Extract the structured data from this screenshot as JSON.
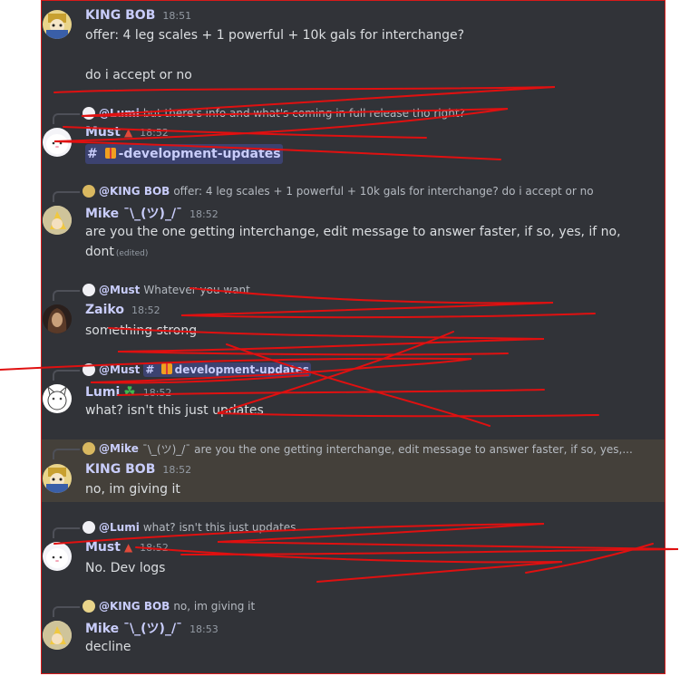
{
  "messages": [
    {
      "author": "KING BOB",
      "time": "18:51",
      "lines": [
        "offer: 4 leg scales + 1 powerful + 10k gals for interchange?",
        "do i accept or no"
      ]
    },
    {
      "reply": {
        "name": "@Lumi",
        "text": "but there's info and what's coming in full release tho right?"
      },
      "author": "Must",
      "role_icon": "▲",
      "time": "18:52",
      "channel": {
        "hash": "#",
        "name": "-development-updates"
      }
    },
    {
      "reply": {
        "name": "@KING BOB",
        "text": "offer: 4 leg scales + 1 powerful + 10k gals for interchange?  do i accept or no"
      },
      "author": "Mike ¯\\_(ツ)_/¯",
      "time": "18:52",
      "lines": [
        "are you the one getting interchange, edit message to answer faster, if so, yes, if no,",
        "dont"
      ],
      "edited": "(edited)"
    },
    {
      "reply": {
        "name": "@Must",
        "text": "Whatever you want"
      },
      "author": "Zaiko",
      "time": "18:52",
      "lines": [
        "something strong"
      ]
    },
    {
      "reply": {
        "name": "@Must",
        "hash": "#",
        "channel": "development-updates"
      },
      "author": "Lumi",
      "role_icon": "☘",
      "time": "18:52",
      "lines": [
        "what? isn't this just updates"
      ]
    },
    {
      "reply": {
        "name": "@Mike",
        "text": "¯\\_(ツ)_/¯  are you the one getting interchange, edit message to answer faster, if so, yes,..."
      },
      "author": "KING BOB",
      "time": "18:52",
      "lines": [
        "no, im giving it"
      ]
    },
    {
      "reply": {
        "name": "@Lumi",
        "text": "what? isn't this just updates"
      },
      "author": "Must",
      "role_icon": "▲",
      "time": "18:52",
      "lines": [
        "No. Dev logs"
      ]
    },
    {
      "reply": {
        "name": "@KING BOB",
        "text": "no, im giving it"
      },
      "author": "Mike ¯\\_(ツ)_/¯",
      "time": "18:53",
      "lines": [
        "decline"
      ]
    }
  ],
  "colors": {
    "background": "#313338",
    "username": "#c9cdfb",
    "text": "#dbdee1",
    "highlight": "#44403a",
    "scribble": "#e01010"
  }
}
